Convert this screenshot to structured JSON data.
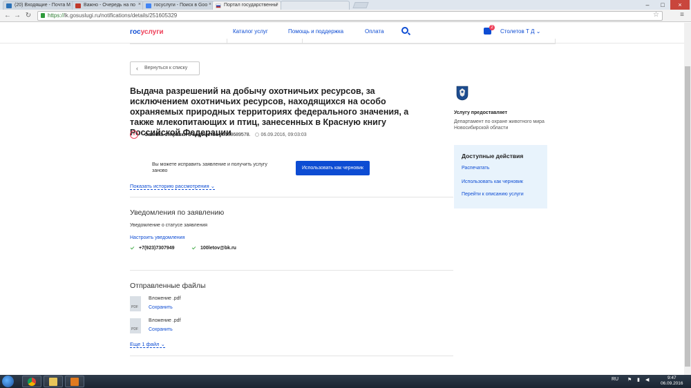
{
  "browser": {
    "tabs": [
      {
        "label": "(20) Входящие - Почта M",
        "active": false
      },
      {
        "label": "Важно - Очередь на по",
        "active": false
      },
      {
        "label": "госуслуги - Поиск в Goo",
        "active": false
      },
      {
        "label": "Портал государственны",
        "active": true
      },
      {
        "label": "",
        "active": false
      }
    ],
    "url_scheme": "https://",
    "url_rest": "lk.gosuslugi.ru/notifications/details/251605329"
  },
  "site": {
    "logo_part1": "гос",
    "logo_part2": "услуги",
    "nav": [
      "Каталог услуг",
      "Помощь и поддержка",
      "Оплата"
    ],
    "notification_count": "2",
    "user_name": "Столетов Т Д"
  },
  "back_label": "Вернуться к списку",
  "title": "Выдача разрешений на добычу охотничьих ресурсов, за исключением охотничьих ресурсов, находящихся на особо охраняемых природных территориях федерального значения, а также млекопитающих и птиц, занесенных в Красную книгу Российской Федерации",
  "status": {
    "label": "Ошибка отправки в ведомство",
    "number": "№138689578.",
    "datetime": "06.09.2016, 09:03:03"
  },
  "fix_text": "Вы можете исправить заявление и получить услугу заново",
  "draft_button": "Использовать как черновик",
  "history_link": "Показать историю рассмотрения",
  "notifications": {
    "title": "Уведомления по заявлению",
    "subtitle": "Уведомление о статусе заявления",
    "settings_link": "Настроить уведомления",
    "phone": "+7(923)7307949",
    "email": "100letov@bk.ru"
  },
  "files": {
    "title": "Отправленные файлы",
    "items": [
      {
        "name": "Вложение .pdf",
        "action": "Сохранить",
        "type": "PDF"
      },
      {
        "name": "Вложение .pdf",
        "action": "Сохранить",
        "type": "PDF"
      }
    ],
    "more": "Еще 1 файл"
  },
  "provider": {
    "label": "Услугу предоставляет",
    "name": "Департамент по охране животного мира Новосибирской области"
  },
  "actions": {
    "title": "Доступные действия",
    "items": [
      "Распечатать",
      "Использовать как черновик",
      "Перейти к описанию услуги"
    ]
  },
  "taskbar": {
    "lang": "RU",
    "time": "9:47",
    "date": "06.09.2016"
  },
  "colors": {
    "brand_blue": "#0d4cd3",
    "brand_red": "#ee3f58",
    "actions_bg": "#e8f3fc"
  }
}
